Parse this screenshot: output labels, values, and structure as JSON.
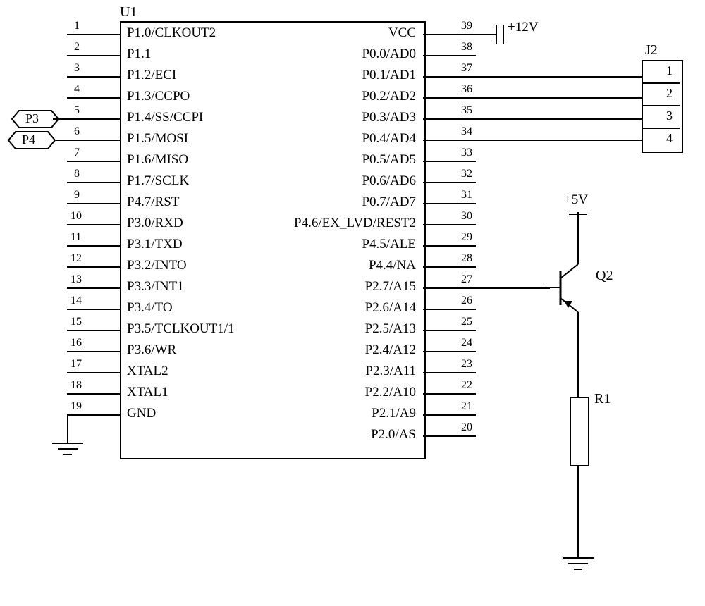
{
  "component_refs": {
    "u1": "U1",
    "j2": "J2",
    "q2": "Q2",
    "r1": "R1",
    "p3": "P3",
    "p4": "P4"
  },
  "voltages": {
    "v12": "+12V",
    "v5": "+5V"
  },
  "left_pins": [
    {
      "num": "1",
      "label": "P1.0/CLKOUT2"
    },
    {
      "num": "2",
      "label": "P1.1"
    },
    {
      "num": "3",
      "label": "P1.2/ECI"
    },
    {
      "num": "4",
      "label": "P1.3/CCPO"
    },
    {
      "num": "5",
      "label": "P1.4/SS/CCPI"
    },
    {
      "num": "6",
      "label": "P1.5/MOSI"
    },
    {
      "num": "7",
      "label": "P1.6/MISO"
    },
    {
      "num": "8",
      "label": "P1.7/SCLK"
    },
    {
      "num": "9",
      "label": "P4.7/RST"
    },
    {
      "num": "10",
      "label": "P3.0/RXD"
    },
    {
      "num": "11",
      "label": "P3.1/TXD"
    },
    {
      "num": "12",
      "label": "P3.2/INTO"
    },
    {
      "num": "13",
      "label": "P3.3/INT1"
    },
    {
      "num": "14",
      "label": "P3.4/TO"
    },
    {
      "num": "15",
      "label": "P3.5/TCLKOUT1/1"
    },
    {
      "num": "16",
      "label": "P3.6/WR"
    },
    {
      "num": "17",
      "label": "XTAL2"
    },
    {
      "num": "18",
      "label": "XTAL1"
    },
    {
      "num": "19",
      "label": "GND"
    }
  ],
  "right_pins": [
    {
      "num": "39",
      "label": "VCC"
    },
    {
      "num": "38",
      "label": "P0.0/AD0"
    },
    {
      "num": "37",
      "label": "P0.1/AD1"
    },
    {
      "num": "36",
      "label": "P0.2/AD2"
    },
    {
      "num": "35",
      "label": "P0.3/AD3"
    },
    {
      "num": "34",
      "label": "P0.4/AD4"
    },
    {
      "num": "33",
      "label": "P0.5/AD5"
    },
    {
      "num": "32",
      "label": "P0.6/AD6"
    },
    {
      "num": "31",
      "label": "P0.7/AD7"
    },
    {
      "num": "30",
      "label": "P4.6/EX_LVD/REST2"
    },
    {
      "num": "29",
      "label": "P4.5/ALE"
    },
    {
      "num": "28",
      "label": "P4.4/NA"
    },
    {
      "num": "27",
      "label": "P2.7/A15"
    },
    {
      "num": "26",
      "label": "P2.6/A14"
    },
    {
      "num": "25",
      "label": "P2.5/A13"
    },
    {
      "num": "24",
      "label": "P2.4/A12"
    },
    {
      "num": "23",
      "label": "P2.3/A11"
    },
    {
      "num": "22",
      "label": "P2.2/A10"
    },
    {
      "num": "21",
      "label": "P2.1/A9"
    },
    {
      "num": "20",
      "label": "P2.0/AS"
    }
  ],
  "j2_pins": [
    "1",
    "2",
    "3",
    "4"
  ]
}
